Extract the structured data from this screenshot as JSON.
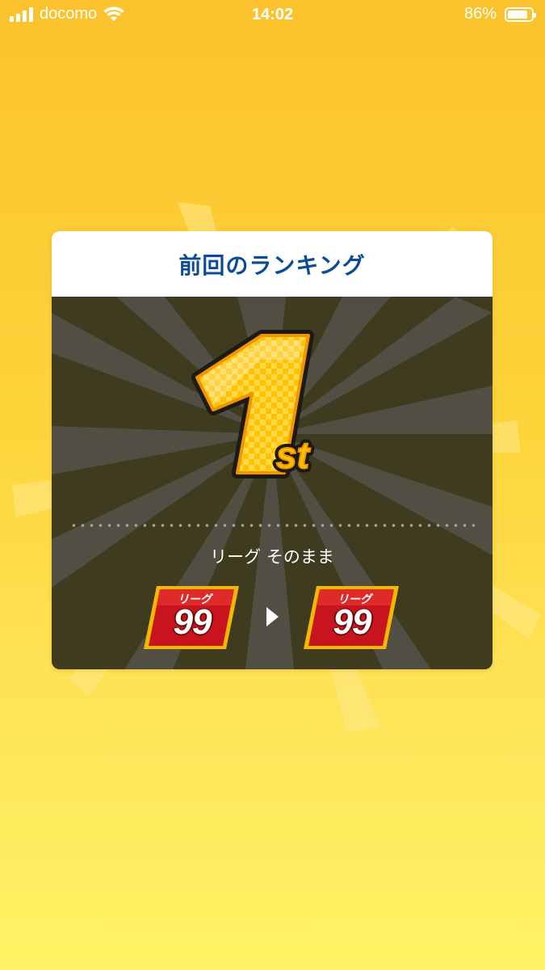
{
  "status_bar": {
    "carrier": "docomo",
    "time": "14:02",
    "battery_percent": "86%",
    "battery_level": 0.86
  },
  "card": {
    "title": "前回のランキング",
    "rank": {
      "number": "1",
      "suffix": "st"
    },
    "result_text": "リーグ そのまま",
    "league_from": {
      "label": "リーグ",
      "number": "99"
    },
    "league_to": {
      "label": "リーグ",
      "number": "99"
    }
  },
  "colors": {
    "background_top": "#fbc22d",
    "background_bottom": "#fff465",
    "title_blue": "#0c4b96",
    "panel_dark": "#3e3b1f",
    "badge_red": "#c8141e",
    "badge_gold": "#f5b800"
  }
}
